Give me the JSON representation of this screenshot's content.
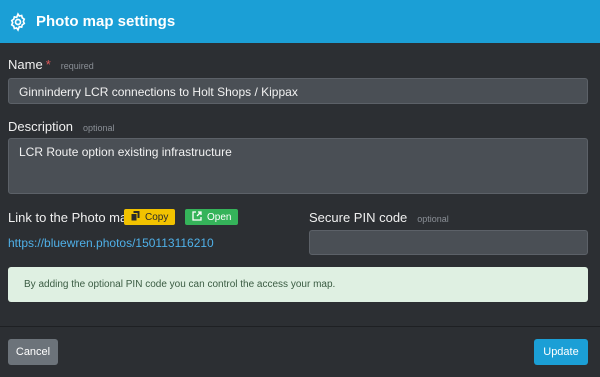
{
  "header": {
    "title": "Photo map settings",
    "icon": "gear-icon"
  },
  "name": {
    "label": "Name",
    "required_mark": "*",
    "hint": "required",
    "value": "Ginninderry LCR connections to Holt Shops / Kippax"
  },
  "description": {
    "label": "Description",
    "hint": "optional",
    "value": "LCR Route option existing infrastructure"
  },
  "link": {
    "label": "Link to the Photo map",
    "copy_label": "Copy",
    "open_label": "Open",
    "url": "https://bluewren.photos/150113116210"
  },
  "pin": {
    "label": "Secure PIN code",
    "hint": "optional",
    "value": ""
  },
  "alert": {
    "text": "By adding the optional PIN code you can control the access your map."
  },
  "footer": {
    "cancel_label": "Cancel",
    "update_label": "Update"
  },
  "colors": {
    "accent": "#1b9fd6",
    "copy": "#f2c200",
    "open": "#35b35a",
    "alert_bg": "#dff0e2"
  }
}
